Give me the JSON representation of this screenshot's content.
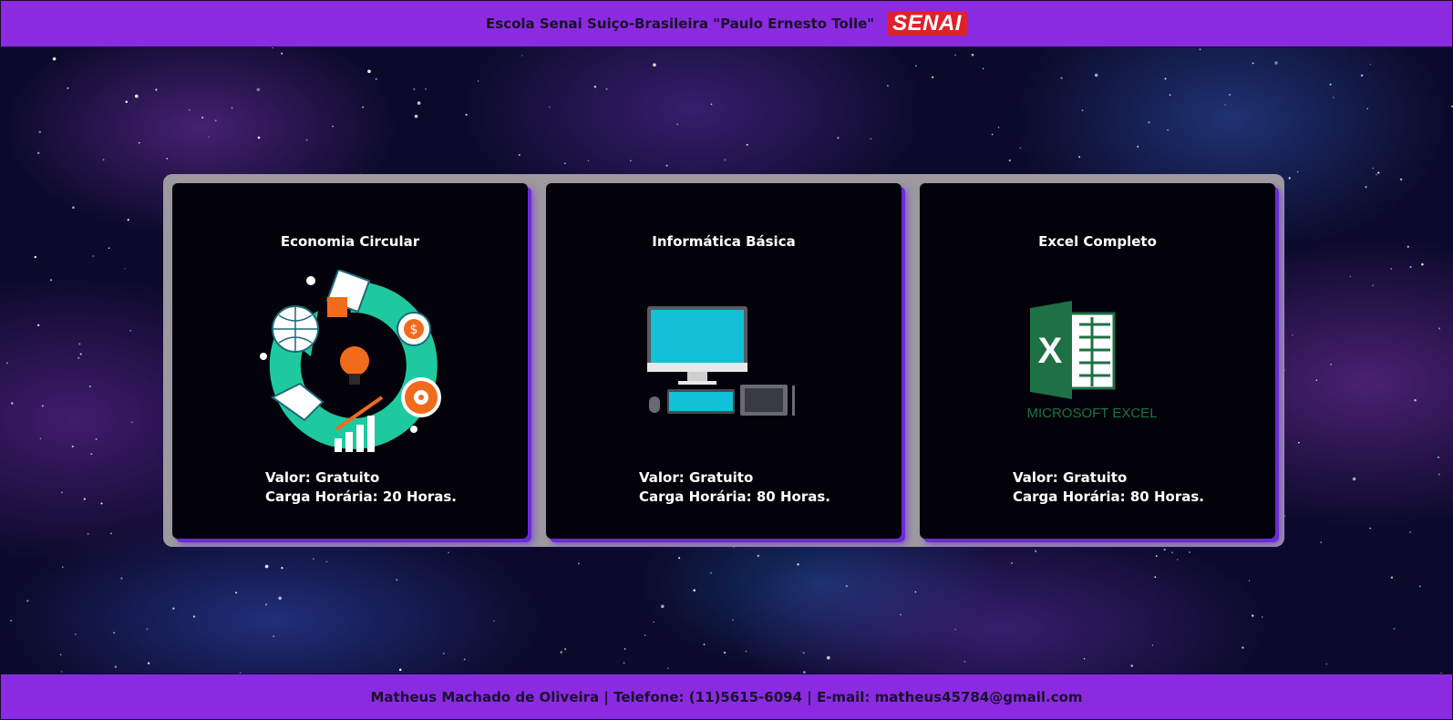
{
  "header": {
    "title": "Escola Senai Suiço-Brasileira \"Paulo Ernesto Tolle\"",
    "logo_text": "SENAI"
  },
  "courses": [
    {
      "title": "Economia Circular",
      "valor": "Valor: Gratuito",
      "carga": "Carga Horária: 20 Horas.",
      "image": "circular-economy-illustration"
    },
    {
      "title": "Informática Básica",
      "valor": "Valor: Gratuito",
      "carga": "Carga Horária: 80 Horas.",
      "image": "computer-illustration"
    },
    {
      "title": "Excel Completo",
      "valor": "Valor: Gratuito",
      "carga": "Carga Horária: 80 Horas.",
      "image": "excel-logo"
    }
  ],
  "excel_logo_text": "MICROSOFT EXCEL",
  "footer": {
    "text": "Matheus Machado de Oliveira | Telefone: (11)5615-6094 | E-mail: matheus45784@gmail.com"
  },
  "colors": {
    "bar": "#8a2be2",
    "card": "#03020a",
    "panel": "#9c9a9e",
    "senai_red": "#e0202a"
  }
}
